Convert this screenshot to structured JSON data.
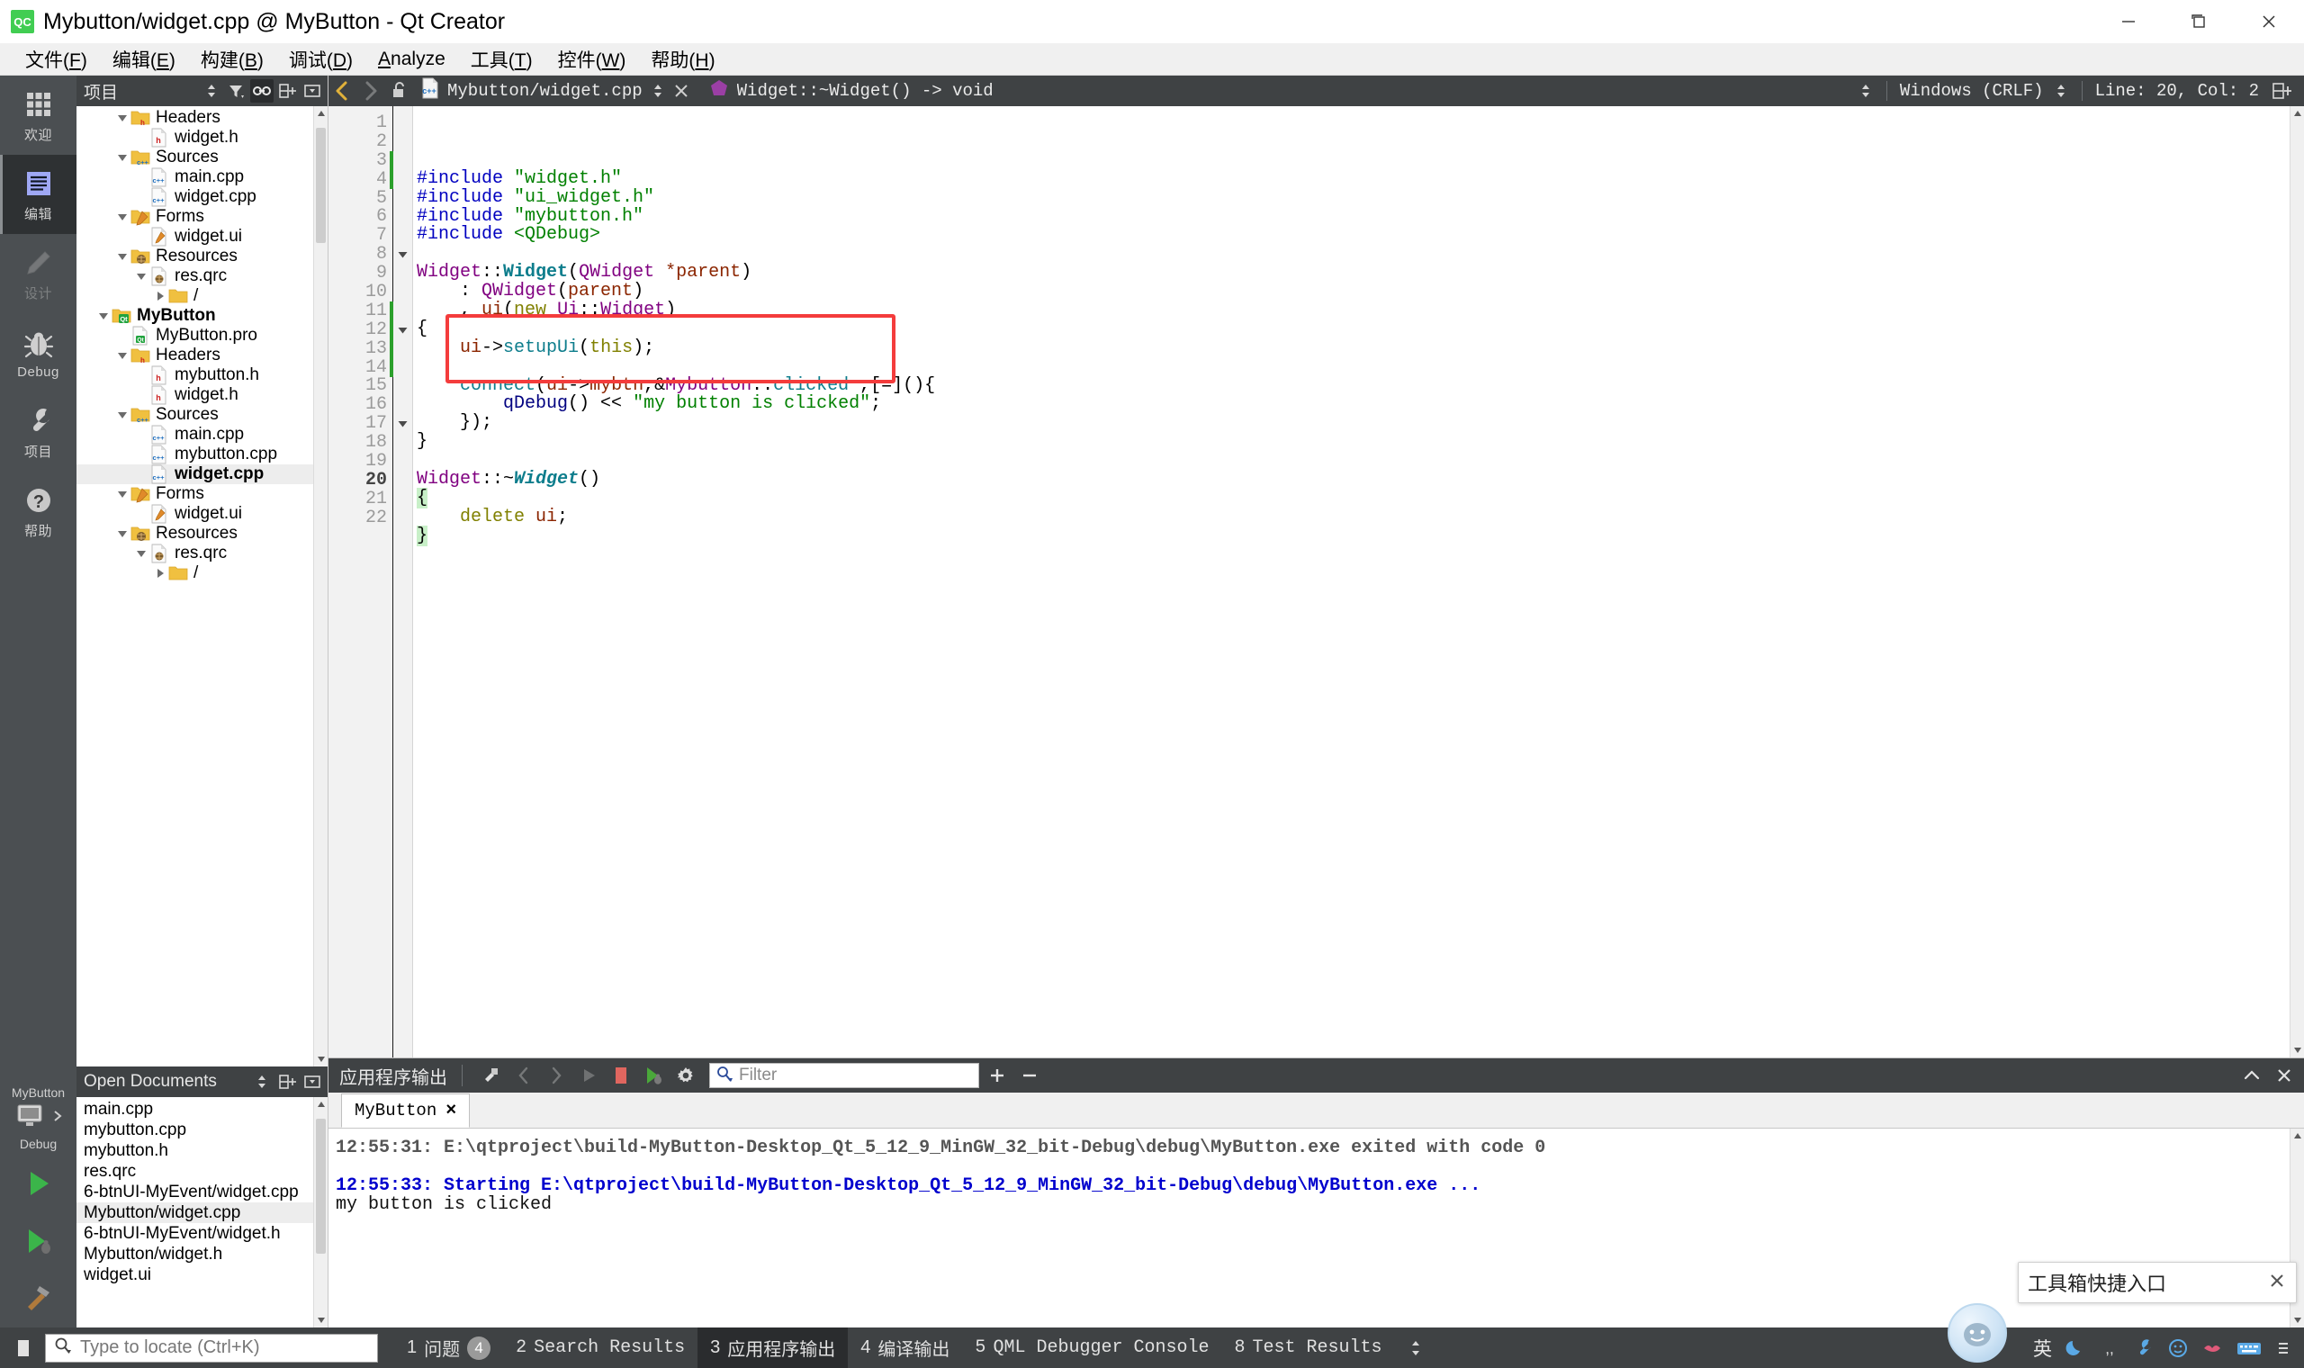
{
  "window": {
    "title": "Mybutton/widget.cpp @ MyButton - Qt Creator",
    "app_icon": "qt-creator-icon",
    "minimize": "minimize-icon",
    "maximize": "maximize-icon",
    "close": "close-icon"
  },
  "menubar": [
    {
      "label": "文件(F)",
      "mnemonic": "F"
    },
    {
      "label": "编辑(E)",
      "mnemonic": "E"
    },
    {
      "label": "构建(B)",
      "mnemonic": "B"
    },
    {
      "label": "调试(D)",
      "mnemonic": "D"
    },
    {
      "label": "Analyze",
      "mnemonic": "A"
    },
    {
      "label": "工具(T)",
      "mnemonic": "T"
    },
    {
      "label": "控件(W)",
      "mnemonic": "W"
    },
    {
      "label": "帮助(H)",
      "mnemonic": "H"
    }
  ],
  "modebar": {
    "modes": [
      {
        "label": "欢迎",
        "icon": "grid-icon",
        "active": false,
        "dim": false
      },
      {
        "label": "编辑",
        "icon": "lines-icon",
        "active": true,
        "dim": false
      },
      {
        "label": "设计",
        "icon": "pencil-icon",
        "active": false,
        "dim": true
      },
      {
        "label": "Debug",
        "icon": "bug-icon",
        "active": false,
        "dim": false
      },
      {
        "label": "项目",
        "icon": "wrench-icon",
        "active": false,
        "dim": false
      },
      {
        "label": "帮助",
        "icon": "question-icon",
        "active": false,
        "dim": false
      }
    ],
    "kit": {
      "project": "MyButton",
      "build_config": "Debug",
      "icon": "desktop-icon"
    },
    "run_button": "run-icon",
    "debug_button": "debug-run-icon",
    "build_button": "hammer-icon"
  },
  "projects_dock": {
    "title": "项目",
    "toolbar": [
      "sync-combo-icon",
      "filter-icon",
      "link-icon",
      "split-icon",
      "close-dock-icon"
    ],
    "tree": [
      {
        "depth": 2,
        "arrow": "down",
        "icon": "folder-h",
        "label": "Headers",
        "bold": false
      },
      {
        "depth": 3,
        "arrow": "none",
        "icon": "file-h",
        "label": "widget.h",
        "bold": false
      },
      {
        "depth": 2,
        "arrow": "down",
        "icon": "folder-cpp",
        "label": "Sources",
        "bold": false
      },
      {
        "depth": 3,
        "arrow": "none",
        "icon": "file-cpp",
        "label": "main.cpp",
        "bold": false
      },
      {
        "depth": 3,
        "arrow": "none",
        "icon": "file-cpp",
        "label": "widget.cpp",
        "bold": false
      },
      {
        "depth": 2,
        "arrow": "down",
        "icon": "folder-form",
        "label": "Forms",
        "bold": false
      },
      {
        "depth": 3,
        "arrow": "none",
        "icon": "file-form",
        "label": "widget.ui",
        "bold": false
      },
      {
        "depth": 2,
        "arrow": "down",
        "icon": "folder-qrc",
        "label": "Resources",
        "bold": false
      },
      {
        "depth": 3,
        "arrow": "down",
        "icon": "file-qrc",
        "label": "res.qrc",
        "bold": false
      },
      {
        "depth": 4,
        "arrow": "right",
        "icon": "folder-plain",
        "label": "/",
        "bold": false
      },
      {
        "depth": 1,
        "arrow": "down",
        "icon": "folder-qt",
        "label": "MyButton",
        "bold": true
      },
      {
        "depth": 2,
        "arrow": "none",
        "icon": "file-pro",
        "label": "MyButton.pro",
        "bold": false
      },
      {
        "depth": 2,
        "arrow": "down",
        "icon": "folder-h",
        "label": "Headers",
        "bold": false
      },
      {
        "depth": 3,
        "arrow": "none",
        "icon": "file-h",
        "label": "mybutton.h",
        "bold": false
      },
      {
        "depth": 3,
        "arrow": "none",
        "icon": "file-h",
        "label": "widget.h",
        "bold": false
      },
      {
        "depth": 2,
        "arrow": "down",
        "icon": "folder-cpp",
        "label": "Sources",
        "bold": false
      },
      {
        "depth": 3,
        "arrow": "none",
        "icon": "file-cpp",
        "label": "main.cpp",
        "bold": false
      },
      {
        "depth": 3,
        "arrow": "none",
        "icon": "file-cpp",
        "label": "mybutton.cpp",
        "bold": false
      },
      {
        "depth": 3,
        "arrow": "none",
        "icon": "file-cpp",
        "label": "widget.cpp",
        "bold": true,
        "selected": true
      },
      {
        "depth": 2,
        "arrow": "down",
        "icon": "folder-form",
        "label": "Forms",
        "bold": false
      },
      {
        "depth": 3,
        "arrow": "none",
        "icon": "file-form",
        "label": "widget.ui",
        "bold": false
      },
      {
        "depth": 2,
        "arrow": "down",
        "icon": "folder-qrc",
        "label": "Resources",
        "bold": false
      },
      {
        "depth": 3,
        "arrow": "down",
        "icon": "file-qrc",
        "label": "res.qrc",
        "bold": false
      },
      {
        "depth": 4,
        "arrow": "right",
        "icon": "folder-plain",
        "label": "/",
        "bold": false
      }
    ]
  },
  "open_documents": {
    "title": "Open Documents",
    "toolbar": [
      "sync-combo-icon",
      "split-icon",
      "close-dock-icon"
    ],
    "items": [
      {
        "label": "main.cpp",
        "selected": false
      },
      {
        "label": "mybutton.cpp",
        "selected": false
      },
      {
        "label": "mybutton.h",
        "selected": false
      },
      {
        "label": "res.qrc",
        "selected": false
      },
      {
        "label": "6-btnUI-MyEvent/widget.cpp",
        "selected": false
      },
      {
        "label": "Mybutton/widget.cpp",
        "selected": true
      },
      {
        "label": "6-btnUI-MyEvent/widget.h",
        "selected": false
      },
      {
        "label": "Mybutton/widget.h",
        "selected": false
      },
      {
        "label": "widget.ui",
        "selected": false
      }
    ]
  },
  "editor_toolbar": {
    "back": "back-arrow-icon",
    "forward": "forward-arrow-icon",
    "lock": "unlocked-icon",
    "file_icon": "cpp-file-icon",
    "file_path": "Mybutton/widget.cpp",
    "symbol_icon": "function-icon",
    "symbol": "Widget::~Widget() -> void",
    "close_editor": "close-editor-icon",
    "line_ending": "Windows (CRLF)",
    "cursor_position": "Line: 20, Col: 2",
    "split_icon": "split-editor-icon"
  },
  "code": {
    "lines": [
      {
        "n": 1,
        "fold": "",
        "changed": false,
        "tokens": [
          {
            "t": "#include ",
            "c": "pre"
          },
          {
            "t": "\"widget.h\"",
            "c": "str"
          }
        ]
      },
      {
        "n": 2,
        "fold": "",
        "changed": false,
        "tokens": [
          {
            "t": "#include ",
            "c": "pre"
          },
          {
            "t": "\"ui_widget.h\"",
            "c": "str"
          }
        ]
      },
      {
        "n": 3,
        "fold": "",
        "changed": true,
        "tokens": [
          {
            "t": "#include ",
            "c": "pre"
          },
          {
            "t": "\"mybutton.h\"",
            "c": "str"
          }
        ]
      },
      {
        "n": 4,
        "fold": "",
        "changed": true,
        "tokens": [
          {
            "t": "#include ",
            "c": "pre"
          },
          {
            "t": "<QDebug>",
            "c": "str"
          }
        ]
      },
      {
        "n": 5,
        "fold": "",
        "changed": false,
        "tokens": []
      },
      {
        "n": 6,
        "fold": "",
        "changed": false,
        "tokens": [
          {
            "t": "Widget",
            "c": "type"
          },
          {
            "t": "::",
            "c": "plain"
          },
          {
            "t": "Widget",
            "c": "fn"
          },
          {
            "t": "(",
            "c": "plain"
          },
          {
            "t": "QWidget ",
            "c": "type"
          },
          {
            "t": "*parent",
            "c": "var"
          },
          {
            "t": ")",
            "c": "plain"
          }
        ]
      },
      {
        "n": 7,
        "fold": "",
        "changed": false,
        "tokens": [
          {
            "t": "    : ",
            "c": "plain"
          },
          {
            "t": "QWidget",
            "c": "type"
          },
          {
            "t": "(",
            "c": "plain"
          },
          {
            "t": "parent",
            "c": "var"
          },
          {
            "t": ")",
            "c": "plain"
          }
        ]
      },
      {
        "n": 8,
        "fold": "down",
        "changed": false,
        "tokens": [
          {
            "t": "    , ",
            "c": "plain"
          },
          {
            "t": "ui",
            "c": "var"
          },
          {
            "t": "(",
            "c": "plain"
          },
          {
            "t": "new ",
            "c": "kw"
          },
          {
            "t": "Ui",
            "c": "type"
          },
          {
            "t": "::",
            "c": "plain"
          },
          {
            "t": "Widget",
            "c": "type"
          },
          {
            "t": ")",
            "c": "plain"
          }
        ]
      },
      {
        "n": 9,
        "fold": "",
        "changed": false,
        "tokens": [
          {
            "t": "{",
            "c": "plain"
          }
        ]
      },
      {
        "n": 10,
        "fold": "",
        "changed": false,
        "tokens": [
          {
            "t": "    ui",
            "c": "var"
          },
          {
            "t": "->",
            "c": "plain"
          },
          {
            "t": "setupUi",
            "c": "fn2"
          },
          {
            "t": "(",
            "c": "plain"
          },
          {
            "t": "this",
            "c": "kw2"
          },
          {
            "t": ");",
            "c": "plain"
          }
        ]
      },
      {
        "n": 11,
        "fold": "",
        "changed": true,
        "tokens": []
      },
      {
        "n": 12,
        "fold": "down",
        "changed": true,
        "tokens": [
          {
            "t": "    connect",
            "c": "fn2"
          },
          {
            "t": "(",
            "c": "plain"
          },
          {
            "t": "ui",
            "c": "var"
          },
          {
            "t": "->",
            "c": "plain"
          },
          {
            "t": "mybtn",
            "c": "var"
          },
          {
            "t": ",&",
            "c": "plain"
          },
          {
            "t": "Mybutton",
            "c": "type"
          },
          {
            "t": "::",
            "c": "plain"
          },
          {
            "t": "clicked",
            "c": "fn2"
          },
          {
            "t": " ,[=](){",
            "c": "plain"
          }
        ]
      },
      {
        "n": 13,
        "fold": "",
        "changed": true,
        "tokens": [
          {
            "t": "        qDebug",
            "c": "num"
          },
          {
            "t": "() ",
            "c": "plain"
          },
          {
            "t": "<< ",
            "c": "plain"
          },
          {
            "t": "\"my button is clicked\"",
            "c": "str"
          },
          {
            "t": ";",
            "c": "plain"
          }
        ]
      },
      {
        "n": 14,
        "fold": "",
        "changed": true,
        "tokens": [
          {
            "t": "    });",
            "c": "plain"
          }
        ]
      },
      {
        "n": 15,
        "fold": "",
        "changed": false,
        "tokens": [
          {
            "t": "}",
            "c": "plain"
          }
        ]
      },
      {
        "n": 16,
        "fold": "",
        "changed": false,
        "tokens": []
      },
      {
        "n": 17,
        "fold": "down",
        "changed": false,
        "tokens": [
          {
            "t": "Widget",
            "c": "type"
          },
          {
            "t": "::~",
            "c": "plain"
          },
          {
            "t": "Widget",
            "c": "virt"
          },
          {
            "t": "()",
            "c": "plain"
          }
        ]
      },
      {
        "n": 18,
        "fold": "",
        "changed": false,
        "tokens": [
          {
            "t": "{",
            "c": "brace"
          }
        ]
      },
      {
        "n": 19,
        "fold": "",
        "changed": false,
        "tokens": [
          {
            "t": "    delete ",
            "c": "kw"
          },
          {
            "t": "ui",
            "c": "var"
          },
          {
            "t": ";",
            "c": "plain"
          }
        ]
      },
      {
        "n": 20,
        "fold": "",
        "changed": false,
        "current": true,
        "tokens": [
          {
            "t": "}",
            "c": "brace"
          }
        ]
      },
      {
        "n": 21,
        "fold": "",
        "changed": false,
        "tokens": []
      },
      {
        "n": 22,
        "fold": "",
        "changed": false,
        "tokens": []
      }
    ],
    "highlight_box": {
      "from_line": 12,
      "to_line": 14,
      "color": "#f43c3c"
    }
  },
  "output_pane": {
    "title": "应用程序输出",
    "toolbar": [
      "clear-icon",
      "prev-icon",
      "next-icon",
      "run-small-icon",
      "stop-icon",
      "debug-small-icon",
      "settings-icon"
    ],
    "filter_icon": "search-icon",
    "filter_placeholder": "Filter",
    "add_button": "plus-icon",
    "remove_button": "minus-icon",
    "maximize_button": "chevron-up-icon",
    "close_button": "close-pane-icon",
    "tabs": [
      {
        "label": "MyButton",
        "close": "×",
        "active": true
      }
    ],
    "console_lines": [
      {
        "text": "12:55:31: E:\\qtproject\\build-MyButton-Desktop_Qt_5_12_9_MinGW_32_bit-Debug\\debug\\MyButton.exe exited with code 0",
        "style": "gray"
      },
      {
        "text": "",
        "style": "black"
      },
      {
        "text": "12:55:33: Starting E:\\qtproject\\build-MyButton-Desktop_Qt_5_12_9_MinGW_32_bit-Debug\\debug\\MyButton.exe ...",
        "style": "blue"
      },
      {
        "text": "my button is clicked",
        "style": "black"
      }
    ]
  },
  "statusbar": {
    "sidebar_toggle": "sidebar-toggle-icon",
    "locator_icon": "search-icon",
    "locator_placeholder": "Type to locate (Ctrl+K)",
    "items": [
      {
        "num": "1",
        "label": "问题",
        "badge": "4",
        "cn": true,
        "active": false
      },
      {
        "num": "2",
        "label": "Search Results",
        "badge": "",
        "cn": false,
        "active": false
      },
      {
        "num": "3",
        "label": "应用程序输出",
        "badge": "",
        "cn": true,
        "active": true
      },
      {
        "num": "4",
        "label": "编译输出",
        "badge": "",
        "cn": true,
        "active": false
      },
      {
        "num": "5",
        "label": "QML Debugger Console",
        "badge": "",
        "cn": false,
        "active": false
      },
      {
        "num": "8",
        "label": "Test Results",
        "badge": "",
        "cn": false,
        "active": false
      }
    ],
    "overflow": "more-panes-icon"
  },
  "ime": {
    "popup_text": "工具箱快捷入口",
    "popup_close": "close-icon",
    "mode_label": "英",
    "icons": [
      "moon-icon",
      "quote-icon",
      "wrench-icon",
      "smiley-icon",
      "lips-icon",
      "keyboard-icon",
      "menu-icon"
    ],
    "assistant": "assistant-avatar"
  }
}
